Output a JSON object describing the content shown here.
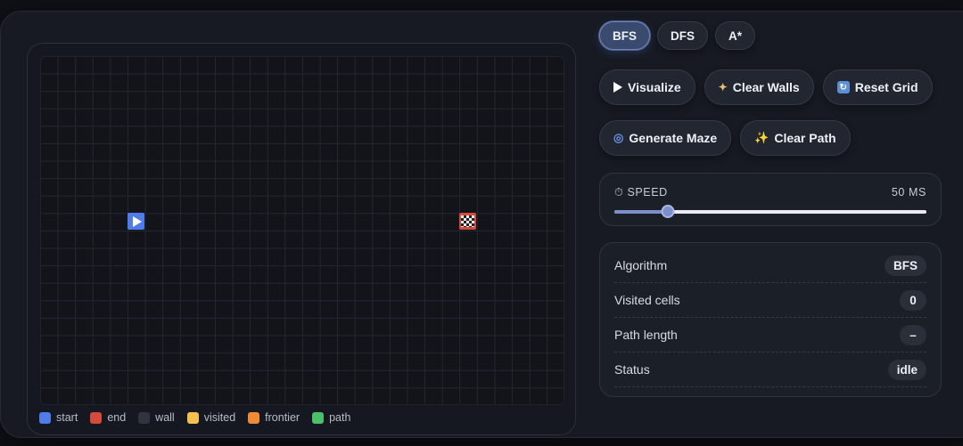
{
  "algorithms": [
    "BFS",
    "DFS",
    "A*"
  ],
  "active_algorithm": "BFS",
  "actions_row1": [
    {
      "label": "Visualize",
      "icon": "play-icon"
    },
    {
      "label": "Clear Walls",
      "icon": "broom-icon"
    },
    {
      "label": "Reset Grid",
      "icon": "reset-icon"
    }
  ],
  "actions_row2": [
    {
      "label": "Generate Maze",
      "icon": "spiral-icon"
    },
    {
      "label": "Clear Path",
      "icon": "sparkles-icon"
    }
  ],
  "speed": {
    "label": "SPEED",
    "value_text": "50 MS",
    "value_ms": 50,
    "level_fraction": 0.17
  },
  "info": {
    "rows": [
      {
        "label": "Algorithm",
        "value": "BFS"
      },
      {
        "label": "Visited cells",
        "value": "0"
      },
      {
        "label": "Path length",
        "value": "–"
      },
      {
        "label": "Status",
        "value": "idle"
      }
    ]
  },
  "legend": [
    {
      "label": "start",
      "color": "#4f7ce8"
    },
    {
      "label": "end",
      "color": "#d44a3d"
    },
    {
      "label": "wall",
      "color": "#2f3440"
    },
    {
      "label": "visited",
      "color": "#f2c14e"
    },
    {
      "label": "frontier",
      "color": "#ef8a35"
    },
    {
      "label": "path",
      "color": "#4cbf6b"
    }
  ],
  "grid": {
    "start_cell": "start",
    "end_cell": "end"
  }
}
